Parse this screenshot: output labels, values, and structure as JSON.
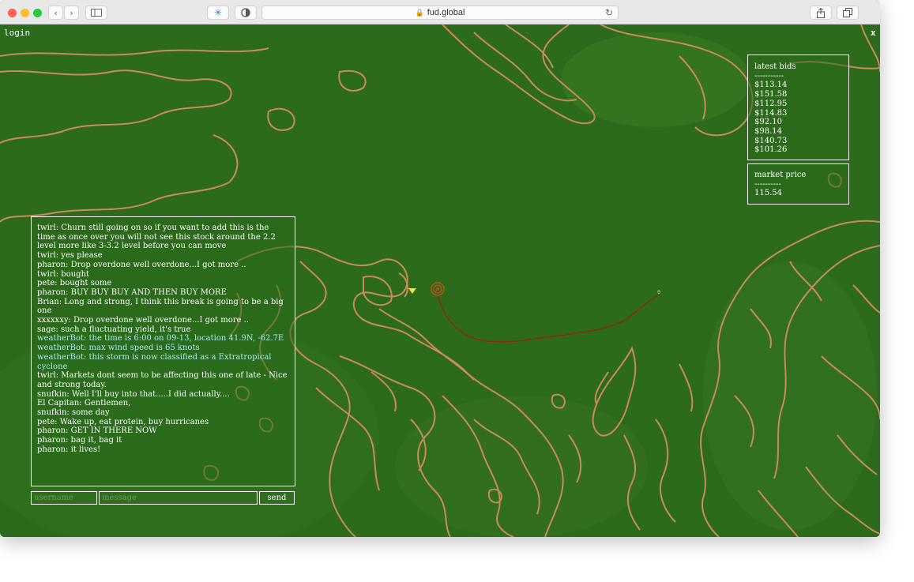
{
  "browser": {
    "url": "fud.global",
    "lock_icon": "lock-icon",
    "reload_icon": "reload-icon",
    "new_tab": "+"
  },
  "page": {
    "login_label": "login",
    "close_label": "x"
  },
  "bids": {
    "title": "latest bids",
    "divider": "-----------",
    "items": [
      "$113.14",
      "$151.58",
      "$112.95",
      "$114.83",
      "$92.10",
      "$98.14",
      "$140.73",
      "$101.26"
    ]
  },
  "market": {
    "title": "market price",
    "divider": "----------",
    "value": "115.54"
  },
  "chat": {
    "messages": [
      {
        "text": "twirl: Churn still going on so if you want to add this is the time as once over you will not see this stock around the 2.2 level more like 3-3.2 level before you can move",
        "bot": false
      },
      {
        "text": "twirl: yes please",
        "bot": false
      },
      {
        "text": "pharon: Drop overdone well overdone...I got more ..",
        "bot": false
      },
      {
        "text": "twirl: bought",
        "bot": false
      },
      {
        "text": "pete: bought some",
        "bot": false
      },
      {
        "text": "pharon: BUY BUY BUY AND THEN BUY MORE",
        "bot": false
      },
      {
        "text": "Brian: Long and strong, I think this break is going to be a big one",
        "bot": false
      },
      {
        "text": "xxxxxxy: Drop overdone well overdone...I got more ..",
        "bot": false
      },
      {
        "text": "sage: such a fluctuating yield, it's true",
        "bot": false
      },
      {
        "text": "weatherBot: the time is 6:00 on 09-13, location 41.9N, -62.7E",
        "bot": true
      },
      {
        "text": "weatherBot: max wind speed is 65 knots",
        "bot": true
      },
      {
        "text": "weatherBot: this storm is now classified as a Extratropical cyclone",
        "bot": true
      },
      {
        "text": "twirl: Markets dont seem to be affecting this one of late - Nice and strong today.",
        "bot": false
      },
      {
        "text": "snufkin: Well I'll buy into that.....I did actually....",
        "bot": false
      },
      {
        "text": "El Capitan: Gentlemen,",
        "bot": false
      },
      {
        "text": "snufkin: some day",
        "bot": false
      },
      {
        "text": "pete: Wake up, eat protein, buy hurricanes",
        "bot": false
      },
      {
        "text": "pharon: GET IN THERE NOW",
        "bot": false
      },
      {
        "text": "pharon: bag it, bag it",
        "bot": false
      },
      {
        "text": "pharon: it lives!",
        "bot": false
      }
    ],
    "username_placeholder": "username",
    "message_placeholder": "message",
    "send_label": "send"
  },
  "storm": {
    "start_label": "0"
  },
  "colors": {
    "sea": "#2d6b1c",
    "land": "#2a6a1c",
    "coast": "#c98a5c",
    "track": "#8b2a12",
    "bot_text": "#aee8ee",
    "marker": "#f0e040"
  }
}
